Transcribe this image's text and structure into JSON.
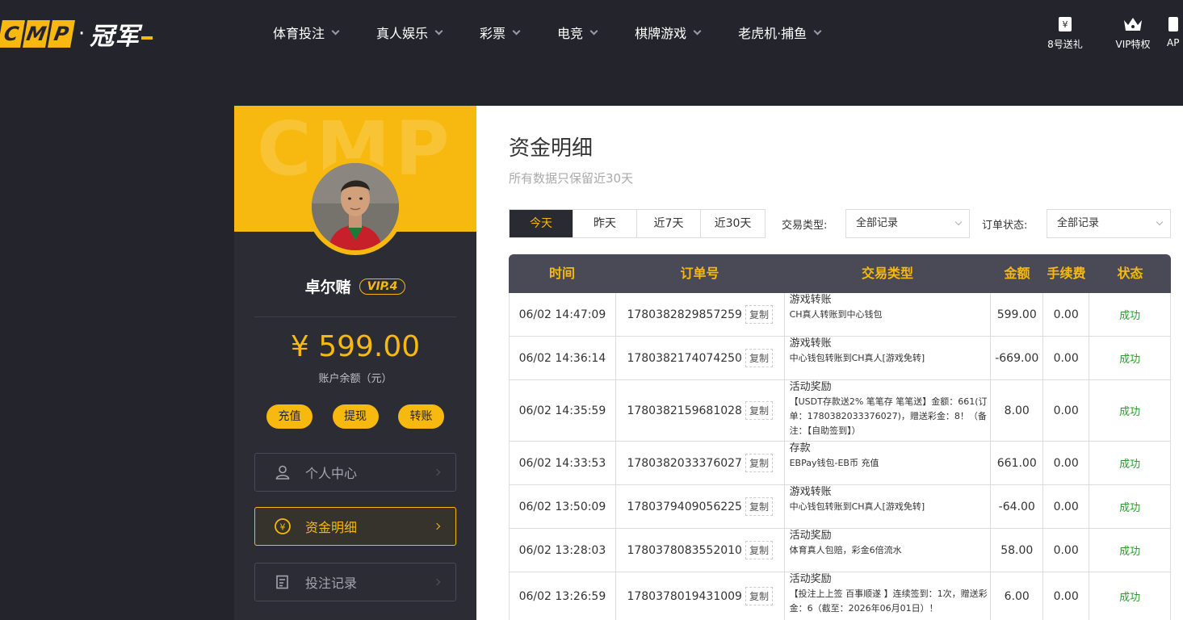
{
  "brand": {
    "letters": [
      "C",
      "M",
      "P"
    ],
    "dot": "·",
    "cn": "冠军"
  },
  "nav": [
    {
      "label": "体育投注"
    },
    {
      "label": "真人娱乐"
    },
    {
      "label": "彩票"
    },
    {
      "label": "电竞"
    },
    {
      "label": "棋牌游戏"
    },
    {
      "label": "老虎机·捕鱼"
    }
  ],
  "tools": {
    "gift": "8号送礼",
    "vip": "VIP特权",
    "api": "AP"
  },
  "colors": {
    "accent": "#f7b90f",
    "dark": "#24242c",
    "success": "#2e9b2e"
  },
  "sidebar": {
    "watermark": "CMP",
    "username": "卓尔赌",
    "vip": "VIP.4",
    "balance": "¥ 599.00",
    "balance_label": "账户余额（元）",
    "actions": {
      "deposit": "充值",
      "withdraw": "提现",
      "transfer": "转账"
    },
    "menu": [
      {
        "label": "个人中心",
        "icon": "user-icon"
      },
      {
        "label": "资金明细",
        "icon": "yuan-coin-icon"
      },
      {
        "label": "投注记录",
        "icon": "bet-record-icon"
      }
    ]
  },
  "main": {
    "title": "资金明细",
    "subtitle": "所有数据只保留近30天",
    "date_tabs": [
      "今天",
      "昨天",
      "近7天",
      "近30天"
    ],
    "filters": {
      "type_label": "交易类型:",
      "type_value": "全部记录",
      "status_label": "订单状态:",
      "status_value": "全部记录"
    },
    "table": {
      "headers": [
        "时间",
        "订单号",
        "交易类型",
        "金额",
        "手续费",
        "状态"
      ],
      "copy_label": "复制",
      "rows": [
        {
          "time": "06/02 14:47:09",
          "order": "1780382829857259",
          "type": "游戏转账",
          "detail": "CH真人转账到中心钱包",
          "amount": "599.00",
          "fee": "0.00",
          "status": "成功"
        },
        {
          "time": "06/02 14:36:14",
          "order": "1780382174074250",
          "type": "游戏转账",
          "detail": "中心钱包转账到CH真人[游戏免转]",
          "amount": "-669.00",
          "fee": "0.00",
          "status": "成功"
        },
        {
          "time": "06/02 14:35:59",
          "order": "1780382159681028",
          "type": "活动奖励",
          "detail": "【USDT存款送2% 笔笔存 笔笔送】金额：661(订单：1780382033376027)，赠送彩金：8！（备注：【自助签到】）",
          "amount": "8.00",
          "fee": "0.00",
          "status": "成功"
        },
        {
          "time": "06/02 14:33:53",
          "order": "1780382033376027",
          "type": "存款",
          "detail": "EBPay钱包-EB币 充值",
          "amount": "661.00",
          "fee": "0.00",
          "status": "成功"
        },
        {
          "time": "06/02 13:50:09",
          "order": "1780379409056225",
          "type": "游戏转账",
          "detail": "中心钱包转账到CH真人[游戏免转]",
          "amount": "-64.00",
          "fee": "0.00",
          "status": "成功"
        },
        {
          "time": "06/02 13:28:03",
          "order": "1780378083552010",
          "type": "活动奖励",
          "detail": "体育真人包赔，彩金6倍流水",
          "amount": "58.00",
          "fee": "0.00",
          "status": "成功"
        },
        {
          "time": "06/02 13:26:59",
          "order": "1780378019431009",
          "type": "活动奖励",
          "detail": "【投注上上签 百事顺遂 】连续签到：1次，赠送彩金：6（截至：2026年06月01日）！",
          "amount": "6.00",
          "fee": "0.00",
          "status": "成功"
        }
      ]
    }
  }
}
